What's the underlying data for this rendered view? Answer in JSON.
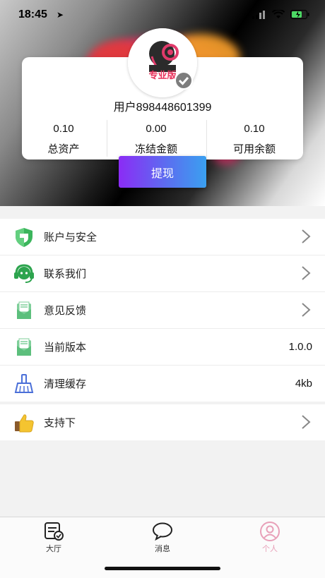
{
  "status_bar": {
    "time": "18:45"
  },
  "profile": {
    "username": "用户898448601399",
    "avatar_text": "专业版",
    "stats": [
      {
        "value": "0.10",
        "label": "总资产"
      },
      {
        "value": "0.00",
        "label": "冻结金额"
      },
      {
        "value": "0.10",
        "label": "可用余额"
      }
    ],
    "withdraw_label": "提现"
  },
  "menu": {
    "items": [
      {
        "label": "账户与安全",
        "icon": "shield-icon",
        "value": ""
      },
      {
        "label": "联系我们",
        "icon": "headset-icon",
        "value": ""
      },
      {
        "label": "意见反馈",
        "icon": "mail-icon",
        "value": ""
      },
      {
        "label": "当前版本",
        "icon": "mail-icon",
        "value": "1.0.0"
      },
      {
        "label": "清理缓存",
        "icon": "broom-icon",
        "value": "4kb"
      }
    ],
    "extra": {
      "label": "支持下",
      "icon": "thumbs-up-icon"
    }
  },
  "tabs": [
    {
      "label": "大厅",
      "icon": "hall-icon",
      "active": false
    },
    {
      "label": "消息",
      "icon": "chat-bubble-icon",
      "active": false
    },
    {
      "label": "个人",
      "icon": "person-icon",
      "active": true
    }
  ],
  "colors": {
    "active_tab": "#e8a0b8",
    "accent_start": "#8b2cf5",
    "accent_end": "#3aa0f0"
  }
}
